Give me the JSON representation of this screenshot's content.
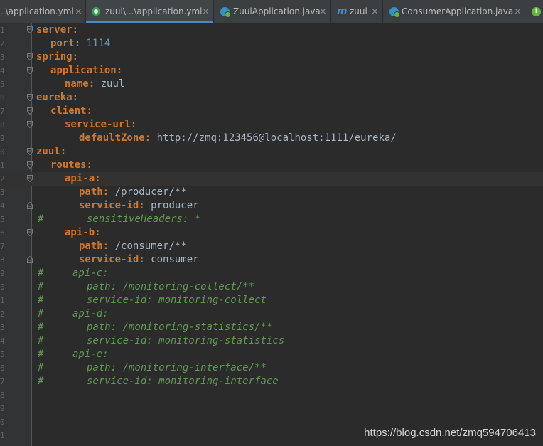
{
  "tabs": [
    {
      "label": "..\\application.yml",
      "icon": "none",
      "active": false
    },
    {
      "label": "zuul\\...\\application.yml",
      "icon": "leaf-icon",
      "active": true
    },
    {
      "label": "ZuulApplication.java",
      "icon": "java-class-icon",
      "active": false
    },
    {
      "label": "zuul",
      "icon": "maven-icon",
      "active": false
    },
    {
      "label": "ConsumerApplication.java",
      "icon": "java-class-icon",
      "active": false
    },
    {
      "label": "",
      "icon": "interface-icon",
      "active": false
    }
  ],
  "close_glyph": "×",
  "interface_icon_letter": "I",
  "line_numbers": [
    "1",
    "2",
    "3",
    "4",
    "5",
    "6",
    "7",
    "8",
    "9",
    "0",
    "1",
    "2",
    "3",
    "4",
    "5",
    "6",
    "7",
    "8",
    "9",
    "0",
    "1",
    "2",
    "3",
    "4",
    "5",
    "6",
    "7",
    "8",
    "9",
    "0",
    "1"
  ],
  "code": [
    {
      "k": "server:"
    },
    {
      "k": "port:",
      "v": "1114",
      "num": true
    },
    {
      "k": "spring:"
    },
    {
      "k": "application:"
    },
    {
      "k": "name:",
      "v": "zuul"
    },
    {
      "k": "eureka:"
    },
    {
      "k": "client:"
    },
    {
      "k": "service-url:"
    },
    {
      "k": "defaultZone:",
      "v": "http://zmq:123456@localhost:1111/eureka/"
    },
    {
      "k": "zuul:"
    },
    {
      "k": "routes:"
    },
    {
      "k": "api-a:"
    },
    {
      "k": "path:",
      "v": "/producer/**"
    },
    {
      "k": "service-id:",
      "v": "producer"
    },
    {
      "hash": "#",
      "c": "sensitiveHeaders: *"
    },
    {
      "k": "api-b:"
    },
    {
      "k": "path:",
      "v": "/consumer/**"
    },
    {
      "k": "service-id:",
      "v": "consumer"
    },
    {
      "hash": "#",
      "c": "api-c:"
    },
    {
      "hash": "#",
      "c": "path: /monitoring-collect/**"
    },
    {
      "hash": "#",
      "c": "service-id: monitoring-collect"
    },
    {
      "hash": "#",
      "c": "api-d:"
    },
    {
      "hash": "#",
      "c": "path: /monitoring-statistics/**"
    },
    {
      "hash": "#",
      "c": "service-id: monitoring-statistics"
    },
    {
      "hash": "#",
      "c": "api-e:"
    },
    {
      "hash": "#",
      "c": "path: /monitoring-interface/**"
    },
    {
      "hash": "#",
      "c": "service-id: monitoring-interface"
    },
    {},
    {},
    {},
    {}
  ],
  "watermark": "https://blog.csdn.net/zmq594706413",
  "colors": {
    "background": "#2b2b2b",
    "keyword": "#cc7832",
    "number": "#6897bb",
    "comment": "#629755",
    "text": "#a9b7c6",
    "tab_underline": "#4a88c7"
  }
}
